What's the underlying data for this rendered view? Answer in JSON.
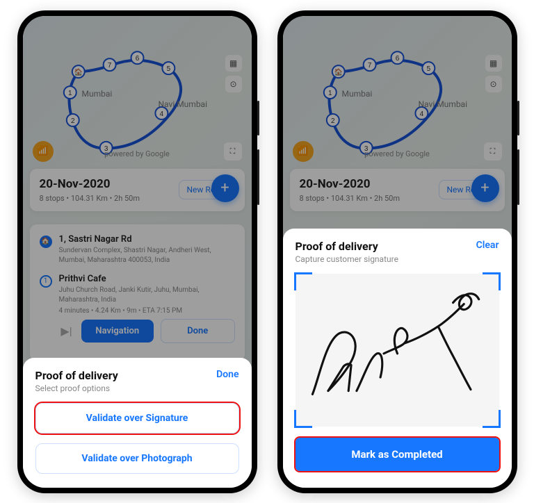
{
  "map": {
    "city1": "Mumbai",
    "city2": "Navi Mumbai",
    "attribution": "powered by Google",
    "stops_count": 7
  },
  "date_card": {
    "date": "20-Nov-2020",
    "summary": "8 stops • 104.31 Km • 2h 50m",
    "new_route": "New Route"
  },
  "stops": {
    "s0": {
      "title": "1, Sastri Nagar Rd",
      "addr": "Sundervan Complex, Shastri Nagar, Andheri West, Mumbai, Maharashtra 400053, India"
    },
    "s1": {
      "pin": "1",
      "title": "Prithvi Cafe",
      "addr": "Juhu Church Road, Janki Kutir, Juhu, Mumbai, Maharashtra, India",
      "meta": "4 minutes • 4.24 Km • 9m • ETA 7:15 PM"
    },
    "nav_label": "Navigation",
    "done_label": "Done"
  },
  "sheet_options": {
    "title": "Proof of delivery",
    "subtitle": "Select proof options",
    "done": "Done",
    "opt_sig": "Validate over Signature",
    "opt_photo": "Validate over Photograph"
  },
  "sheet_sig": {
    "title": "Proof of delivery",
    "subtitle": "Capture customer signature",
    "clear": "Clear",
    "complete": "Mark as Completed"
  }
}
